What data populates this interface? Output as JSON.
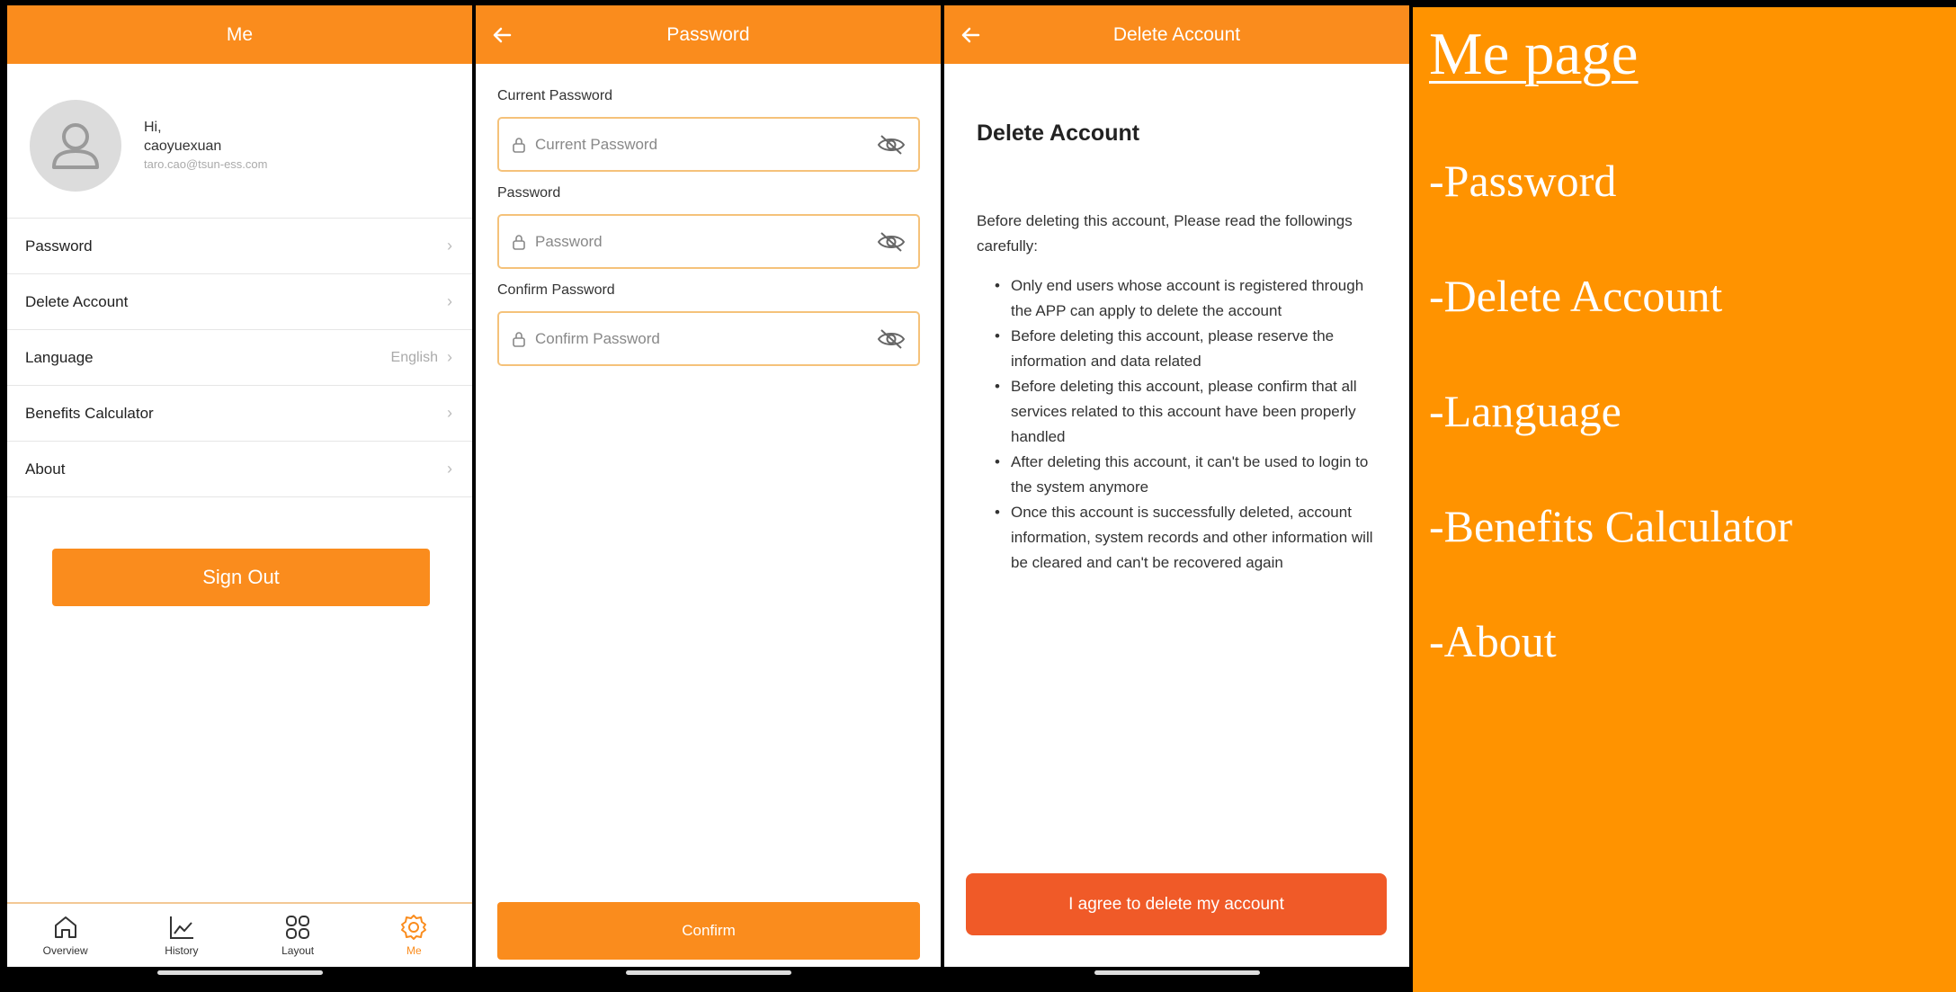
{
  "me_screen": {
    "title": "Me",
    "greeting": "Hi,",
    "username": "caoyuexuan",
    "email": "taro.cao@tsun-ess.com",
    "menu": [
      {
        "label": "Password",
        "value": ""
      },
      {
        "label": "Delete Account",
        "value": ""
      },
      {
        "label": "Language",
        "value": "English"
      },
      {
        "label": "Benefits Calculator",
        "value": ""
      },
      {
        "label": "About",
        "value": ""
      }
    ],
    "sign_out": "Sign Out",
    "tabs": [
      {
        "label": "Overview",
        "icon": "home-icon"
      },
      {
        "label": "History",
        "icon": "chart-icon"
      },
      {
        "label": "Layout",
        "icon": "grid-icon"
      },
      {
        "label": "Me",
        "icon": "gear-icon",
        "active": true
      }
    ]
  },
  "password_screen": {
    "title": "Password",
    "fields": [
      {
        "label": "Current Password",
        "placeholder": "Current Password"
      },
      {
        "label": "Password",
        "placeholder": "Password"
      },
      {
        "label": "Confirm Password",
        "placeholder": "Confirm Password"
      }
    ],
    "confirm": "Confirm"
  },
  "delete_screen": {
    "title": "Delete Account",
    "heading": "Delete Account",
    "intro": "Before deleting this account, Please read the followings carefully:",
    "bullets": [
      "Only end users whose account is registered through the APP can apply to delete the account",
      "Before deleting this account, please reserve the information and data related",
      "Before deleting this account, please confirm that all services related to this account have been properly handled",
      "After deleting this account, it can't be used to login to the system anymore",
      "Once this account is successfully deleted, account information, system records and other information will be cleared and can't be recovered again"
    ],
    "agree": "I agree to delete my account"
  },
  "panel": {
    "title": "Me page",
    "items": [
      "-Password",
      "-Delete Account",
      "-Language",
      "-Benefits Calculator",
      "-About"
    ]
  },
  "colors": {
    "accent": "#fa8c1d",
    "danger": "#f05a28",
    "panel": "#ff9300"
  }
}
